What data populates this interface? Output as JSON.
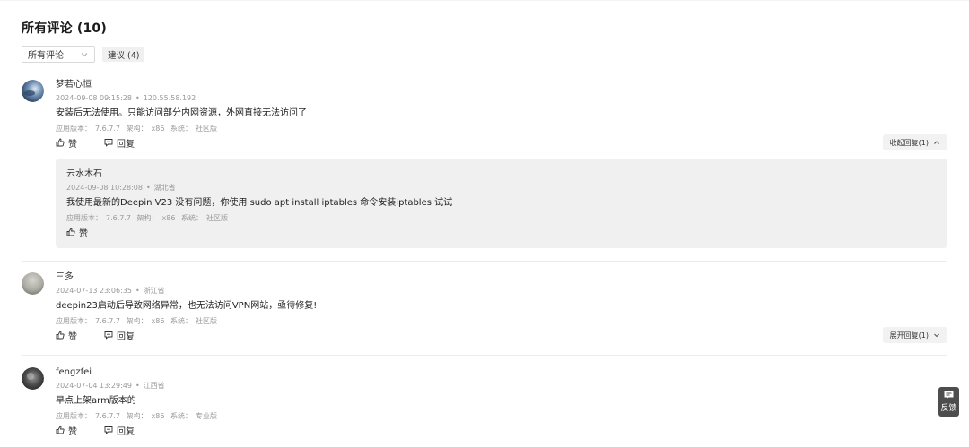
{
  "header": {
    "title": "所有评论 (10)"
  },
  "filters": {
    "select_value": "所有评论",
    "chip_label": "建议 (4)"
  },
  "meta_labels": {
    "app_version": "应用版本：",
    "arch": "架构：",
    "system": "系统："
  },
  "actions": {
    "like": "赞",
    "reply": "回复"
  },
  "comments": [
    {
      "user": "梦若心恒",
      "time": "2024-09-08 09:15:28",
      "location": "120.55.58.192",
      "text": "安装后无法使用。只能访问部分内网资源，外网直接无法访问了",
      "app_version": "7.6.7.7",
      "arch": "x86",
      "system": "社区版",
      "toggle": "收起回复(1)",
      "reply": {
        "user": "云水木石",
        "time": "2024-09-08 10:28:08",
        "location": "湖北省",
        "text": "我使用最新的Deepin V23 没有问题，你使用 sudo apt install iptables 命令安装iptables 试试",
        "app_version": "7.6.7.7",
        "arch": "x86",
        "system": "社区版"
      }
    },
    {
      "user": "三多",
      "time": "2024-07-13 23:06:35",
      "location": "浙江省",
      "text": "deepin23启动后导致网络异常，也无法访问VPN网站，亟待修复!",
      "app_version": "7.6.7.7",
      "arch": "x86",
      "system": "社区版",
      "toggle": "展开回复(1)"
    },
    {
      "user": "fengzfei",
      "time": "2024-07-04 13:29:49",
      "location": "江西省",
      "text": "早点上架arm版本的",
      "app_version": "7.6.7.7",
      "arch": "x86",
      "system": "专业版"
    }
  ],
  "feedback": {
    "label": "反馈"
  },
  "icons": {
    "like": "thumbs-up-icon",
    "reply": "chat-bubble-icon",
    "chevron_up": "chevron-up-icon",
    "chevron_down": "chevron-down-icon",
    "feedback": "message-icon"
  }
}
